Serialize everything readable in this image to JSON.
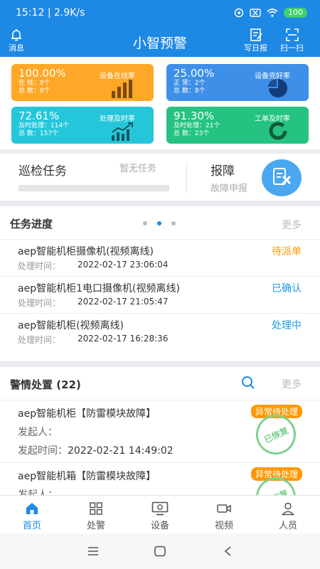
{
  "status_bar": {
    "time": "15:12",
    "speed": "2.9K/s",
    "battery": "100"
  },
  "header": {
    "title": "小智预警",
    "left_label": "消息",
    "daily_label": "写日报",
    "scan_label": "扫一扫"
  },
  "stats": [
    {
      "pct": "100.00%",
      "caption": "设备在线率",
      "line1": "在  线：8个",
      "line2": "总  数：8个",
      "color": "#ffa726"
    },
    {
      "pct": "25.00%",
      "caption": "设备完好率",
      "line1": "正  常：2个",
      "line2": "总  数：8个",
      "color": "#3d8fe8"
    },
    {
      "pct": "72.61%",
      "caption": "处理及时率",
      "line1": "及时处理：114个",
      "line2": "总  数：157个",
      "color": "#26c6da"
    },
    {
      "pct": "91.30%",
      "caption": "工单及时率",
      "line1": "及时处理：21个",
      "line2": "总  数：23个",
      "color": "#26c281"
    }
  ],
  "quick": {
    "inspect_title": "巡检任务",
    "inspect_sub": "暂无任务",
    "report_title": "报障",
    "report_sub": "故障申报"
  },
  "progress": {
    "title": "任务进度",
    "more": "更多",
    "time_label": "处理时间：",
    "tasks": [
      {
        "name": "aep智能机柜摄像机(视频离线)",
        "time": "2022-02-17 23:06:04",
        "status": "待派单",
        "status_color": "#ff9800"
      },
      {
        "name": "aep智能机柜1电口摄像机(视频离线)",
        "time": "2022-02-17 21:05:47",
        "status": "已确认",
        "status_color": "#1e9be5"
      },
      {
        "name": "aep智能机柜(视频离线)",
        "time": "2022-02-17 16:28:36",
        "status": "处理中",
        "status_color": "#1e9be5"
      }
    ]
  },
  "alarm": {
    "title": "警情处置 (22)",
    "more": "更多",
    "initiator_label": "发起人：",
    "time_label": "发起时间：",
    "items": [
      {
        "name": "aep智能机柜【防雷模块故障】",
        "time": "2022-02-21 14:49:02",
        "badge": "异常待处理",
        "stamp": "已恢复"
      },
      {
        "name": "aep智能机箱【防雷模块故障】",
        "time": "",
        "badge": "异常待处理",
        "stamp": "已恢复"
      }
    ]
  },
  "tabs": [
    {
      "label": "首页",
      "icon": "home-icon"
    },
    {
      "label": "处警",
      "icon": "grid-icon"
    },
    {
      "label": "设备",
      "icon": "monitor-icon"
    },
    {
      "label": "视频",
      "icon": "camera-icon"
    },
    {
      "label": "人员",
      "icon": "person-icon"
    }
  ]
}
